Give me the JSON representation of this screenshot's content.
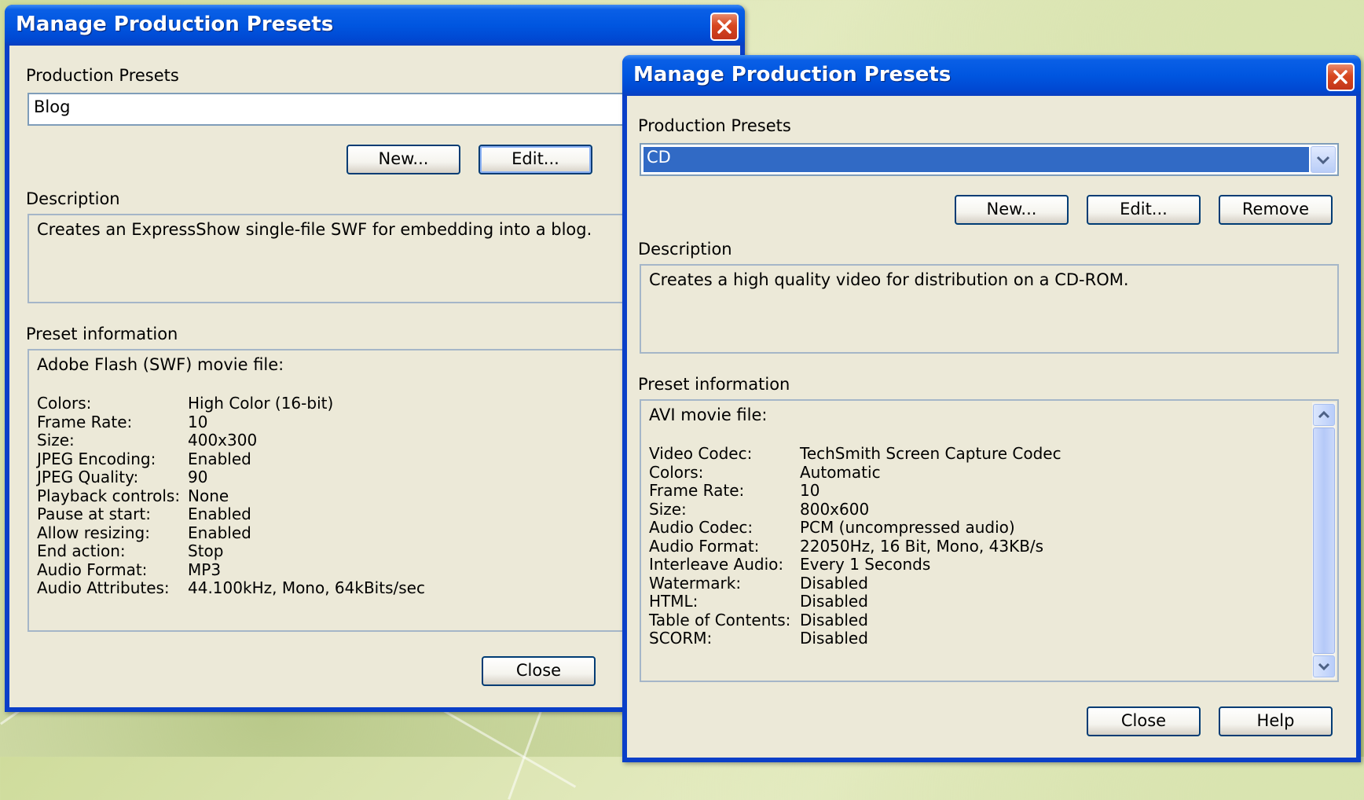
{
  "window_left": {
    "title": "Manage Production Presets",
    "presets_label": "Production Presets",
    "selected_preset": "Blog",
    "buttons": {
      "new": "New...",
      "edit": "Edit...",
      "close": "Close"
    },
    "description_label": "Description",
    "description": "Creates an ExpressShow single-file SWF for embedding into a blog.",
    "preset_info_label": "Preset information",
    "preset_info_header": "Adobe Flash (SWF) movie file:",
    "preset_info": [
      {
        "key": "Colors:",
        "value": "High Color (16-bit)"
      },
      {
        "key": "Frame Rate:",
        "value": "10"
      },
      {
        "key": "Size:",
        "value": "400x300"
      },
      {
        "key": "JPEG Encoding:",
        "value": "Enabled"
      },
      {
        "key": "JPEG Quality:",
        "value": "90"
      },
      {
        "key": "Playback controls:",
        "value": "None"
      },
      {
        "key": "Pause at start:",
        "value": "Enabled"
      },
      {
        "key": "Allow resizing:",
        "value": "Enabled"
      },
      {
        "key": "End action:",
        "value": "Stop"
      },
      {
        "key": "Audio Format:",
        "value": "MP3"
      },
      {
        "key": "Audio Attributes:",
        "value": "44.100kHz, Mono, 64kBits/sec"
      }
    ]
  },
  "window_right": {
    "title": "Manage Production Presets",
    "presets_label": "Production Presets",
    "selected_preset": "CD",
    "buttons": {
      "new": "New...",
      "edit": "Edit...",
      "remove": "Remove",
      "close": "Close",
      "help": "Help"
    },
    "description_label": "Description",
    "description": "Creates a high quality video for distribution on a CD-ROM.",
    "preset_info_label": "Preset information",
    "preset_info_header": "AVI movie file:",
    "preset_info": [
      {
        "key": "Video Codec:",
        "value": "TechSmith Screen Capture Codec"
      },
      {
        "key": "Colors:",
        "value": "Automatic"
      },
      {
        "key": "Frame Rate:",
        "value": "10"
      },
      {
        "key": "Size:",
        "value": "800x600"
      },
      {
        "key": "Audio Codec:",
        "value": "PCM (uncompressed audio)"
      },
      {
        "key": "Audio Format:",
        "value": "22050Hz, 16 Bit, Mono, 43KB/s"
      },
      {
        "key": "Interleave Audio:",
        "value": "Every 1 Seconds"
      },
      {
        "key": "Watermark:",
        "value": "Disabled"
      },
      {
        "key": "HTML:",
        "value": "Disabled"
      },
      {
        "key": "Table of Contents:",
        "value": "Disabled"
      },
      {
        "key": "SCORM:",
        "value": "Disabled"
      }
    ]
  },
  "icons": {
    "close": "close-icon",
    "dropdown": "chevron-down-icon",
    "scroll_up": "scroll-up-arrow-icon",
    "scroll_down": "scroll-down-arrow-icon"
  },
  "colors": {
    "titlebar": "#0054e3",
    "client": "#ece9d8",
    "selection": "#316ac5",
    "close_button": "#d7471f"
  }
}
